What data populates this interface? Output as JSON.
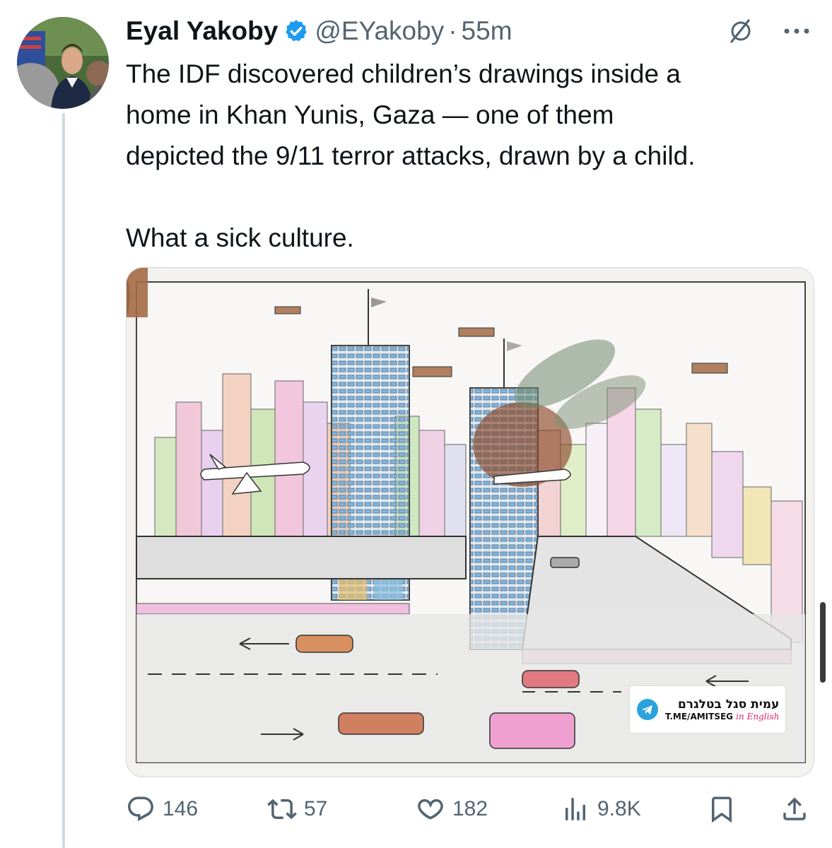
{
  "tweet": {
    "author": {
      "display_name": "Eyal Yakoby",
      "handle": "@EYakoby",
      "separator": "·",
      "time": "55m",
      "verified": true
    },
    "text": "The IDF discovered children’s drawings inside a\nhome in Khan Yunis, Gaza — one of them\ndepicted the 9/11 terror attacks, drawn by a child.\n\nWhat a sick culture.",
    "media": {
      "watermark_line1": "עמית סגל בטלגרם",
      "watermark_handle": "T.ME/AMITSEG",
      "watermark_lang": "in English"
    },
    "actions": {
      "replies": "146",
      "reposts": "57",
      "likes": "182",
      "views": "9.8K"
    }
  },
  "colors": {
    "verified_blue": "#1d9bf0",
    "secondary_text": "#536471",
    "thread_line": "#cfd9de"
  },
  "icons": [
    "verified-badge-icon",
    "grok-icon",
    "more-icon",
    "reply-icon",
    "repost-icon",
    "like-icon",
    "views-icon",
    "bookmark-icon",
    "share-icon"
  ]
}
